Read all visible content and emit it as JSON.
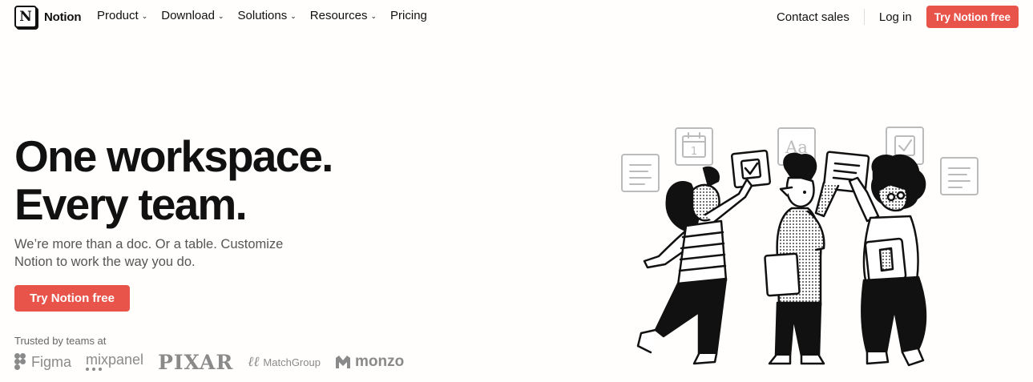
{
  "nav": {
    "brand": "Notion",
    "brand_logo_letter": "N",
    "links": [
      {
        "label": "Product",
        "dropdown": true
      },
      {
        "label": "Download",
        "dropdown": true
      },
      {
        "label": "Solutions",
        "dropdown": true
      },
      {
        "label": "Resources",
        "dropdown": true
      },
      {
        "label": "Pricing",
        "dropdown": false
      }
    ],
    "contact_sales": "Contact sales",
    "log_in": "Log in",
    "cta": "Try Notion free"
  },
  "hero": {
    "title_line1": "One workspace.",
    "title_line2": "Every team.",
    "subtitle": "We’re more than a doc. Or a table. Customize Notion to work the way you do.",
    "cta": "Try Notion free",
    "trusted_label": "Trusted by teams at",
    "logos": {
      "figma": "Figma",
      "mixpanel": "mixpanel",
      "pixar": "PIXAR",
      "matchgroup": "MatchGroup",
      "monzo": "monzo"
    },
    "illustration_aa": "Aa",
    "illustration_calendar_day": "1"
  },
  "colors": {
    "accent": "#e9544a",
    "background": "#fffefc",
    "text": "#111111",
    "muted": "#555555",
    "logo_gray": "#8a8a8a"
  }
}
